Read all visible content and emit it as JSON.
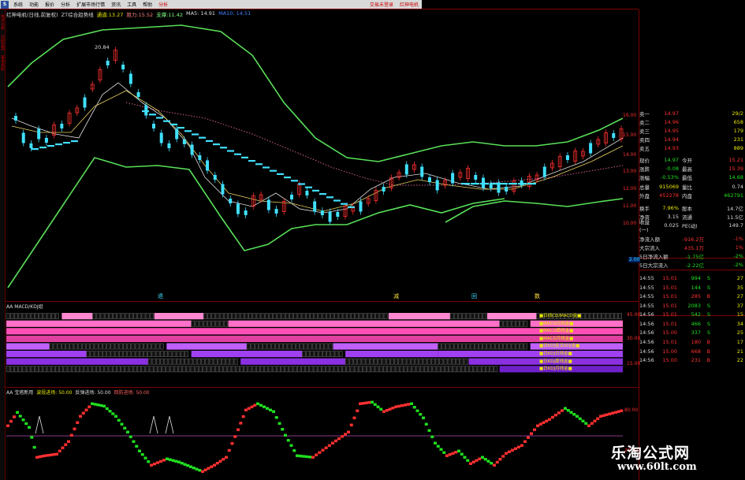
{
  "menu": {
    "logo": "S",
    "items": [
      "系统",
      "功能",
      "报价",
      "分析",
      "扩展市场行情",
      "资讯",
      "工具",
      "帮助"
    ],
    "active": "分析",
    "right": [
      "交易未登录",
      "红神电机"
    ]
  },
  "left_strip": [
    "技术分析",
    "分时走势",
    "基本资料"
  ],
  "main_header": {
    "title": "红神电机(日线,前复权)",
    "indicator": "ZT综合趋势线",
    "tongdao": "通道:13.27",
    "zuli": "阻力:15.52",
    "zhicheng": "支撑:11.42",
    "ma5": "MA5: 14.91",
    "ma10": "MA10: 14.51"
  },
  "price_axis": [
    "16.00",
    "15.00",
    "14.00",
    "13.00",
    "12.00",
    "11.00",
    "10.00"
  ],
  "high_price_label": "20.84",
  "left_price_tag": "2.00",
  "signal_markers": [
    "退",
    "减",
    "回",
    "数"
  ],
  "indicator1": {
    "header": "AA MACD/KDJ组",
    "rows": [
      "■日线CD/MACD金■",
      "■MACD日线金■",
      "■MACD周线金■",
      "■MACD月线金■",
      "■日KDJ金叉KDJ金■",
      "■日KDJ日线金■",
      "■日KDJ周线金■",
      "■日KDJ月线金■"
    ],
    "axis": [
      "45.00",
      "30.00",
      "15.00"
    ]
  },
  "indicator2": {
    "header_name": "AA 宝塔新用",
    "header_items": [
      "波段进场: 50.00",
      "反弹进场: 50.00",
      "回防进场: 50.00"
    ],
    "axis": [
      "80.00",
      "20.00"
    ]
  },
  "quotes": {
    "sell": [
      {
        "label": "卖一",
        "price": "14.97",
        "vol": "29/2"
      },
      {
        "label": "卖二",
        "price": "14.96",
        "vol": "658"
      },
      {
        "label": "卖三",
        "price": "14.95",
        "vol": "179"
      },
      {
        "label": "卖四",
        "price": "14.94",
        "vol": "231"
      },
      {
        "label": "卖五",
        "price": "14.93",
        "vol": "889"
      }
    ],
    "stats": [
      {
        "l1": "现价",
        "v1": "14.97",
        "l2": "今开",
        "v2": "15.21",
        "c1": "green",
        "c2": "red"
      },
      {
        "l1": "涨跌",
        "v1": "-0.08",
        "l2": "最高",
        "v2": "15.39",
        "c1": "green",
        "c2": "red"
      },
      {
        "l1": "涨幅",
        "v1": "-0.53%",
        "l2": "最低",
        "v2": "14.68",
        "c1": "green",
        "c2": "green"
      },
      {
        "l1": "总量",
        "v1": "915069",
        "l2": "量比",
        "v2": "0.74",
        "c1": "yel",
        "c2": "white"
      },
      {
        "l1": "外盘",
        "v1": "452278",
        "l2": "内盘",
        "v2": "462791",
        "c1": "red",
        "c2": "green"
      }
    ],
    "stats2": [
      {
        "l1": "换手",
        "v1": "7.96%",
        "l2": "股本",
        "v2": "14.7亿"
      },
      {
        "l1": "净资",
        "v1": "3.15",
        "l2": "流通",
        "v2": "11.5亿"
      },
      {
        "l1": "收益(一)",
        "v1": "0.025",
        "l2": "PE(动)",
        "v2": "149.7"
      }
    ],
    "flows": [
      {
        "label": "净流入额",
        "value": "-916.2万",
        "pct": "-1%",
        "c": "red"
      },
      {
        "label": "大宗流入",
        "value": "435.1万",
        "pct": "1%",
        "c": "red"
      },
      {
        "label": "5日净流入额",
        "value": "-1.75亿",
        "pct": "-2%",
        "c": "green"
      },
      {
        "label": "5日大宗流入",
        "value": "-2.22亿",
        "pct": "-2%",
        "c": "green"
      }
    ],
    "ticks": [
      {
        "t": "14:55",
        "p": "15.01",
        "v": "994",
        "bs": "S",
        "x": "27"
      },
      {
        "t": "14:55",
        "p": "15.01",
        "v": "144",
        "bs": "S",
        "x": "35"
      },
      {
        "t": "14:55",
        "p": "15.01",
        "v": "285",
        "bs": "B",
        "x": "27"
      },
      {
        "t": "14:55",
        "p": "15.01",
        "v": "2083",
        "bs": "S",
        "x": "37"
      },
      {
        "t": "14:56",
        "p": "15.01",
        "v": "542",
        "bs": "S",
        "x": "15"
      },
      {
        "t": "14:56",
        "p": "15.01",
        "v": "466",
        "bs": "S",
        "x": "34"
      },
      {
        "t": "14:56",
        "p": "15.00",
        "v": "337",
        "bs": "S",
        "x": "25"
      },
      {
        "t": "14:56",
        "p": "15.01",
        "v": "180",
        "bs": "B",
        "x": "17"
      },
      {
        "t": "14:56",
        "p": "15.00",
        "v": "668",
        "bs": "B",
        "x": "21"
      },
      {
        "t": "14:56",
        "p": "15.00",
        "v": "231",
        "bs": "B",
        "x": "22"
      }
    ]
  },
  "watermark": {
    "cn": "乐淘公式网",
    "url": "www.60lt.com"
  },
  "colors": {
    "up": "#ff3030",
    "down": "#20e020",
    "band": "#58e058",
    "cyan": "#40e0ff",
    "magenta": "#ff6ad5",
    "purple": "#9a32ff"
  }
}
